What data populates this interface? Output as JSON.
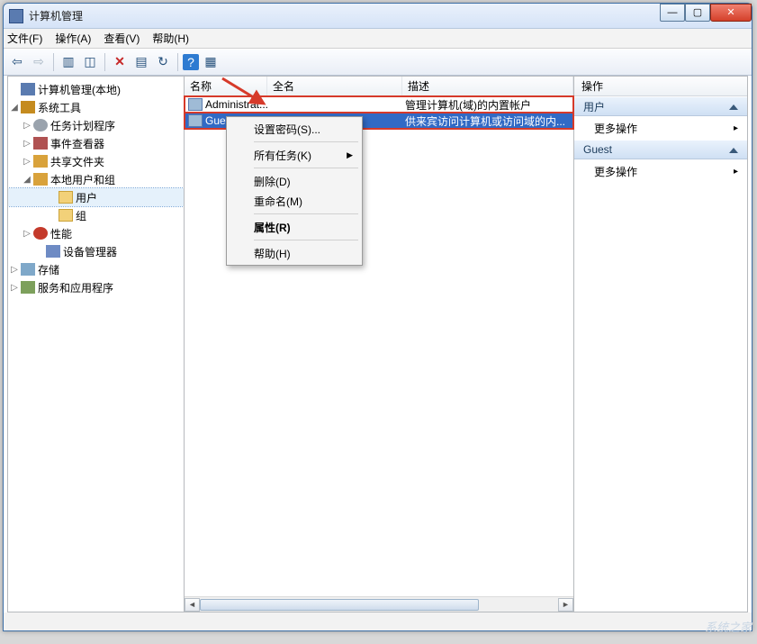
{
  "window": {
    "title": "计算机管理"
  },
  "menubar": {
    "file": "文件(F)",
    "action": "操作(A)",
    "view": "查看(V)",
    "help": "帮助(H)"
  },
  "tree": {
    "root": "计算机管理(本地)",
    "sys_tools": "系统工具",
    "task_sched": "任务计划程序",
    "event_viewer": "事件查看器",
    "shared": "共享文件夹",
    "local_users": "本地用户和组",
    "users": "用户",
    "groups": "组",
    "perf": "性能",
    "devmgr": "设备管理器",
    "storage": "存储",
    "services": "服务和应用程序"
  },
  "list": {
    "col_name": "名称",
    "col_full": "全名",
    "col_desc": "描述",
    "rows": [
      {
        "name": "Administrat...",
        "full": "",
        "desc": "管理计算机(域)的内置帐户"
      },
      {
        "name": "Guest",
        "full": "",
        "desc": "供来宾访问计算机或访问域的内..."
      }
    ]
  },
  "context": {
    "set_pwd": "设置密码(S)...",
    "all_tasks": "所有任务(K)",
    "delete": "删除(D)",
    "rename": "重命名(M)",
    "properties": "属性(R)",
    "help": "帮助(H)"
  },
  "actions": {
    "header": "操作",
    "section1": "用户",
    "more1": "更多操作",
    "section2": "Guest",
    "more2": "更多操作"
  },
  "watermark": "系统之家"
}
